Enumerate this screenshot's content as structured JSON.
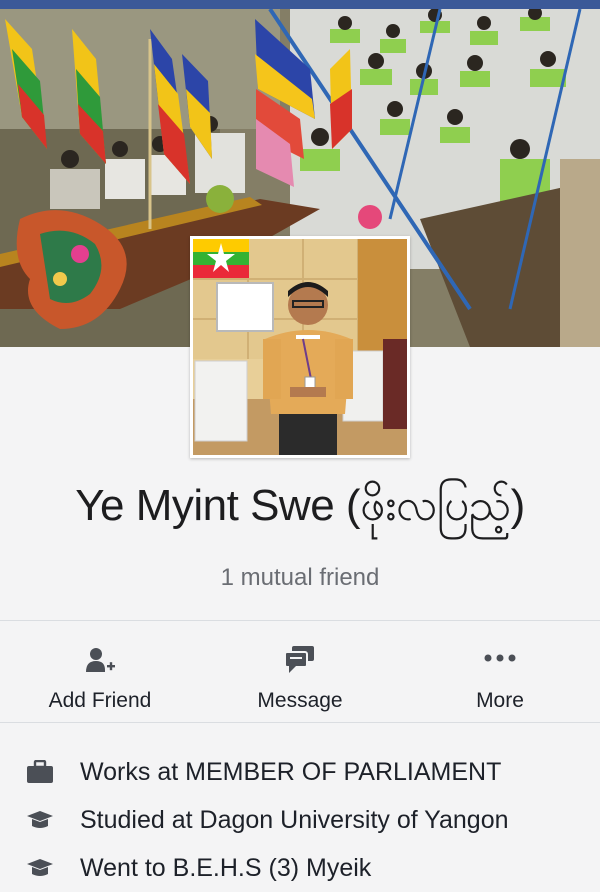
{
  "profile": {
    "name": "Ye Myint Swe (ဖိုးလပြည့်)",
    "mutual_friends": "1 mutual friend"
  },
  "actions": [
    {
      "label": "Add Friend",
      "icon": "add-friend-icon"
    },
    {
      "label": "Message",
      "icon": "message-icon"
    },
    {
      "label": "More",
      "icon": "more-dots-icon"
    }
  ],
  "intro": [
    {
      "text": "Works at MEMBER OF PARLIAMENT",
      "icon": "briefcase-icon"
    },
    {
      "text": "Studied at Dagon University of Yangon",
      "icon": "graduation-cap-icon"
    },
    {
      "text": "Went to B.E.H.S (3) Myeik",
      "icon": "graduation-cap-icon"
    }
  ],
  "colors": {
    "brand_strip": "#3b5998",
    "text_primary": "#1d2129",
    "text_secondary": "#6a6d73",
    "icon_gray": "#4b4f56"
  }
}
